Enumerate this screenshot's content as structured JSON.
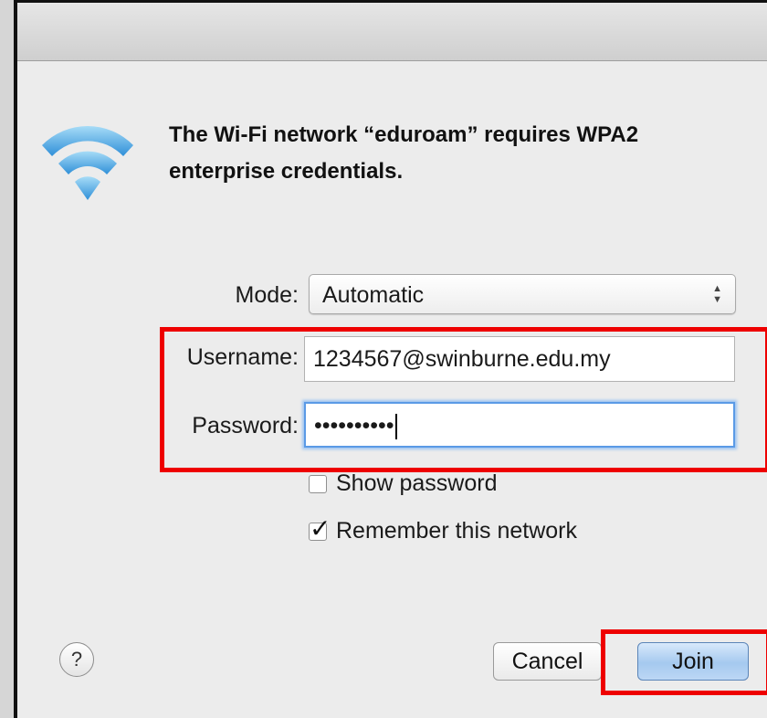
{
  "dialog": {
    "message_line1": "The Wi-Fi network “eduroam” requires WPA2",
    "message_line2": "enterprise credentials.",
    "icon": "wifi-icon"
  },
  "form": {
    "mode_label": "Mode:",
    "mode_value": "Automatic",
    "username_label": "Username:",
    "username_value": "1234567@swinburne.edu.my",
    "password_label": "Password:",
    "password_value": "••••••••••"
  },
  "options": {
    "show_password_label": "Show password",
    "show_password_checked": false,
    "remember_label": "Remember this network",
    "remember_checked": true
  },
  "buttons": {
    "help_label": "?",
    "cancel_label": "Cancel",
    "join_label": "Join"
  },
  "annotation": {
    "highlight_color": "#ee0000"
  },
  "colors": {
    "focus_ring": "#5a9ae6",
    "default_button": "#a5c9ef"
  }
}
